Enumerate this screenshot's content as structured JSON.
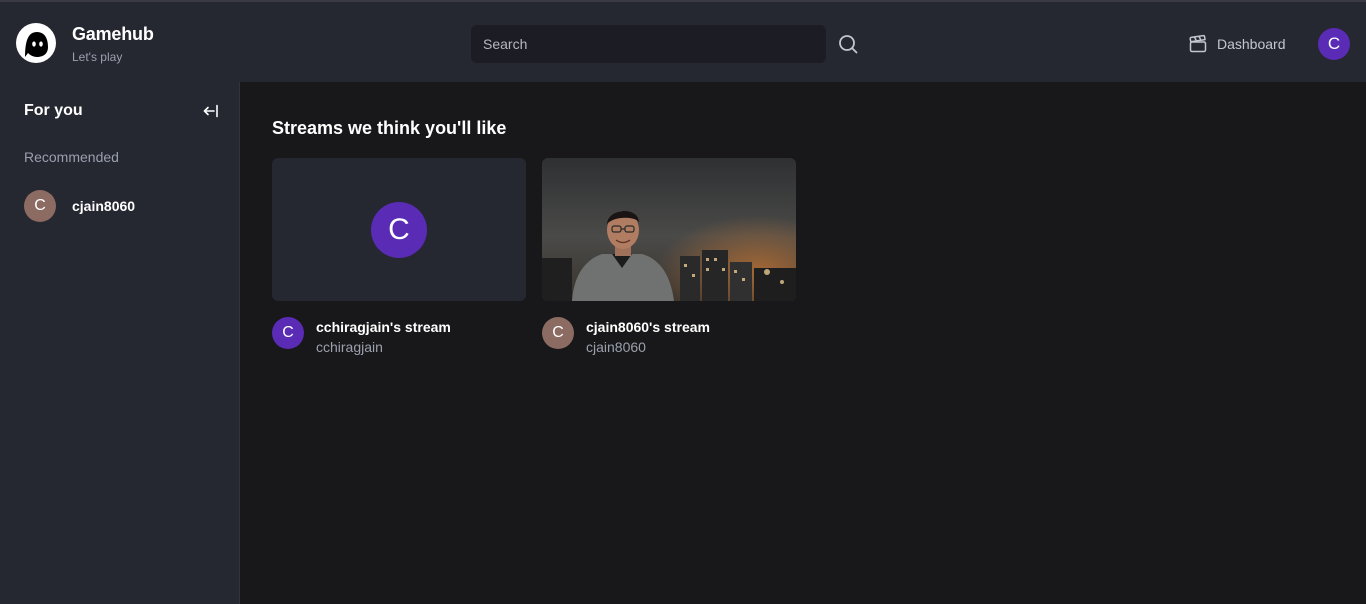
{
  "header": {
    "logo_icon": "ghost-face-icon",
    "app_name": "Gamehub",
    "tagline": "Let's play",
    "search": {
      "placeholder": "Search",
      "value": "",
      "icon": "search-icon"
    },
    "dashboard_label": "Dashboard",
    "dashboard_icon": "clapperboard-icon",
    "user_initial": "C"
  },
  "sidebar": {
    "title": "For you",
    "collapse_icon": "arrow-left-to-line-icon",
    "section_label": "Recommended",
    "users": [
      {
        "initial": "C",
        "name": "cjain8060"
      }
    ]
  },
  "main": {
    "section_title": "Streams we think you'll like",
    "streams": [
      {
        "title": "cchiragjain's stream",
        "username": "cchiragjain",
        "initial": "C",
        "thumbnail_initial": "C",
        "has_image": false
      },
      {
        "title": "cjain8060's stream",
        "username": "cjain8060",
        "initial": "C",
        "has_image": true
      }
    ]
  },
  "colors": {
    "topbar_bg": "#252731",
    "page_bg": "#18181a",
    "accent_purple": "#5a2bb5",
    "avatar_brown": "#8c6b62",
    "muted_text": "#9aa0ad"
  }
}
